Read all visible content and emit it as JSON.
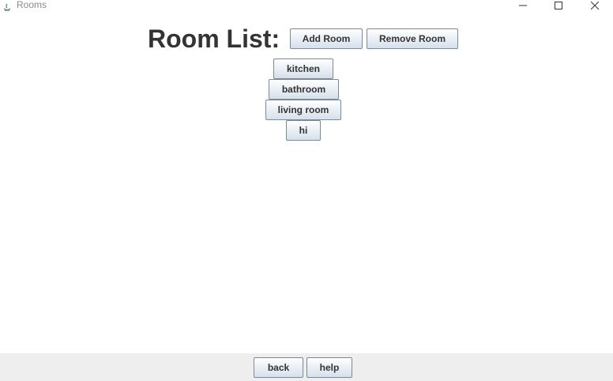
{
  "window": {
    "title": "Rooms",
    "controls": [
      "minimize-icon",
      "maximize-icon",
      "close-icon"
    ]
  },
  "header": {
    "title": "Room List:",
    "add_room_label": "Add Room",
    "remove_room_label": "Remove Room"
  },
  "rooms": [
    {
      "label": "kitchen"
    },
    {
      "label": "bathroom"
    },
    {
      "label": "living room"
    },
    {
      "label": "hi"
    }
  ],
  "footer": {
    "back_label": "back",
    "help_label": "help"
  },
  "colors": {
    "title_text": "#333333",
    "button_border": "#7a8a99",
    "footer_background": "#eeeeee"
  }
}
